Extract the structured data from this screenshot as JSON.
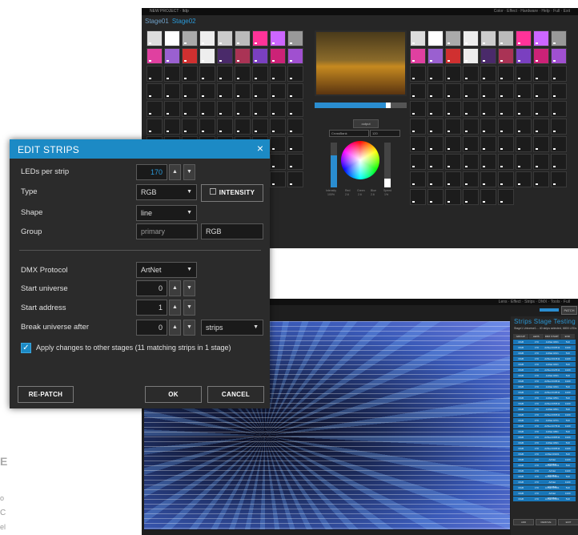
{
  "top_window": {
    "title": "NEW PROJECT · ltdp",
    "menu": "Color · Effect · Hardware · Help · Full · Exit",
    "tabs": [
      "Stage01",
      "Stage02"
    ],
    "output_button": "output",
    "select_a": "CrossBank",
    "select_b": "120",
    "progress": 0.8,
    "sliders": [
      {
        "label": "Intensity",
        "value": "100%",
        "level": 0.72
      },
      {
        "label": "Speed",
        "value": "1%",
        "level": 0.2
      }
    ],
    "wheel_labels": [
      "Red",
      "Green",
      "Blue"
    ],
    "wheel_values": [
      "2.6",
      "2.6",
      "2.6"
    ]
  },
  "bottom_window": {
    "menu": "Lens · Effect · Strips · DMX · Tools · Full",
    "patch_button": "PATCH",
    "side_tabs": "Strips Stage Testing",
    "side_info": "Stage1    Universe1...    40 strips selected, 6800 LEDs",
    "table_headers": [
      "GROUP",
      "LEDS",
      "DMX START",
      "END"
    ],
    "table_rows": [
      [
        "RGB",
        "170",
        "ArtNet 0/0/1",
        "510"
      ],
      [
        "RGB",
        "170",
        "ArtNet 0/0/511",
        "1020"
      ],
      [
        "RGB",
        "170",
        "ArtNet 0/1/1",
        "510"
      ],
      [
        "RGB",
        "170",
        "ArtNet 0/1/511",
        "1020"
      ],
      [
        "RGB",
        "170",
        "ArtNet 0/2/1",
        "510"
      ],
      [
        "RGB",
        "170",
        "ArtNet 0/2/511",
        "1020"
      ],
      [
        "RGB",
        "170",
        "ArtNet 0/3/1",
        "510"
      ],
      [
        "RGB",
        "170",
        "ArtNet 0/3/511",
        "1020"
      ],
      [
        "RGB",
        "170",
        "ArtNet 0/4/1",
        "510"
      ],
      [
        "RGB",
        "170",
        "ArtNet 0/4/511",
        "1020"
      ],
      [
        "RGB",
        "170",
        "ArtNet 0/5/1",
        "510"
      ],
      [
        "RGB",
        "170",
        "ArtNet 0/5/511",
        "1020"
      ],
      [
        "RGB",
        "170",
        "ArtNet 0/6/1",
        "510"
      ],
      [
        "RGB",
        "170",
        "ArtNet 0/6/511",
        "1020"
      ],
      [
        "RGB",
        "170",
        "ArtNet 0/7/1",
        "510"
      ],
      [
        "RGB",
        "170",
        "ArtNet 0/7/511",
        "1020"
      ],
      [
        "RGB",
        "170",
        "ArtNet 0/8/1",
        "510"
      ],
      [
        "RGB",
        "170",
        "ArtNet 0/8/511",
        "1020"
      ],
      [
        "RGB",
        "170",
        "ArtNet 0/9/1",
        "510"
      ],
      [
        "RGB",
        "170",
        "ArtNet 0/9/511",
        "1020"
      ],
      [
        "RGB",
        "170",
        "ArtNet 0/10/1",
        "510"
      ],
      [
        "RGB",
        "170",
        "ArtNet 0/10/511",
        "1020"
      ],
      [
        "RGB",
        "170",
        "ArtNet 0/11/1",
        "510"
      ],
      [
        "RGB",
        "170",
        "ArtNet 0/11/511",
        "1020"
      ],
      [
        "RGB",
        "170",
        "ArtNet 0/12/1",
        "510"
      ],
      [
        "RGB",
        "170",
        "ArtNet 0/12/511",
        "1020"
      ],
      [
        "RGB",
        "170",
        "ArtNet 0/13/1",
        "510"
      ],
      [
        "RGB",
        "170",
        "ArtNet 0/13/511",
        "1020"
      ],
      [
        "RGB",
        "170",
        "ArtNet 0/14/1",
        "510"
      ]
    ],
    "side_buttons": [
      "ADD",
      "REMOVE",
      "EDIT"
    ]
  },
  "dialog": {
    "title": "EDIT STRIPS",
    "close": "×",
    "leds_label": "LEDs per strip",
    "leds_value": "170",
    "type_label": "Type",
    "type_value": "RGB",
    "intensity_button": "INTENSITY",
    "shape_label": "Shape",
    "shape_value": "line",
    "group_label": "Group",
    "group_value": "primary",
    "group_value2": "RGB",
    "dmx_label": "DMX Protocol",
    "dmx_value": "ArtNet",
    "start_universe_label": "Start universe",
    "start_universe_value": "0",
    "start_address_label": "Start address",
    "start_address_value": "1",
    "break_label": "Break universe after",
    "break_value": "0",
    "break_unit": "strips",
    "apply_label": "Apply changes to other stages (11 matching strips in 1 stage)",
    "repatch": "RE-PATCH",
    "ok": "OK",
    "cancel": "CANCEL"
  },
  "page_edge": {
    "letter": "E",
    "frag1": "o",
    "frag2": "C",
    "frag3": "el"
  },
  "colors": {
    "accent": "#1c8ac5",
    "dialog_bg": "#2b2b2b",
    "app_bg": "#262626"
  }
}
